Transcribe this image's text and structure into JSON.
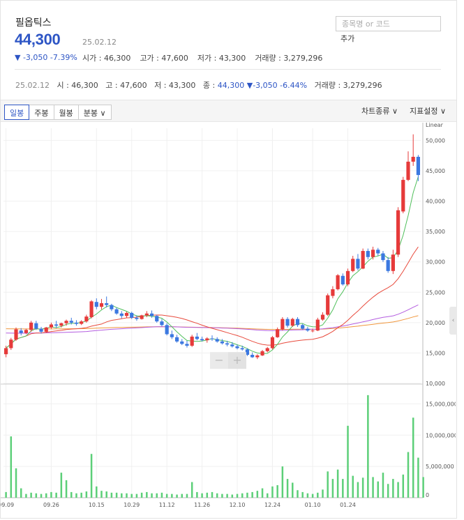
{
  "stock": {
    "name": "필옵틱스",
    "price": "44,300",
    "date": "25.02.12",
    "change": "▼ -3,050  -7.39%",
    "open": "시가 : 46,300",
    "high": "고가 : 47,600",
    "low": "저가 : 43,300",
    "volume": "거래량 : 3,279,296"
  },
  "search": {
    "placeholder": "종목명 or 코드",
    "add_label": "추가"
  },
  "ohlc_line": {
    "date": "25.02.12",
    "open": "시 : 46,300",
    "high": "고 : 47,600",
    "low": "저 : 43,300",
    "close_label": "종 :",
    "close": "44,300",
    "change": "▼-3,050 -6.44%",
    "volume": "거래량 : 3,279,296"
  },
  "toolbar": {
    "tabs": [
      "일봉",
      "주봉",
      "월봉",
      "분봉 ∨"
    ],
    "chart_type": "차트종류 ∨",
    "indicator": "지표설정 ∨"
  },
  "colors": {
    "up": "#e63a3a",
    "down": "#3b78e0",
    "ma5": "#4fbf5a",
    "ma20": "#e84a3c",
    "ma60": "#b45de0",
    "ma120": "#f0963c",
    "volume": "#5ccf78"
  },
  "chart_data": {
    "type": "candlestick",
    "scale_label": "Linear",
    "price_ticks": [
      "50,000",
      "45,000",
      "40,000",
      "35,000",
      "30,000",
      "25,000",
      "20,000",
      "15,000",
      "10,000"
    ],
    "volume_ticks": [
      "15,000,000",
      "10,000,000",
      "5,000,000",
      "0"
    ],
    "x_ticks": [
      "09.09",
      "09.26",
      "10.15",
      "10.29",
      "11.12",
      "11.26",
      "12.10",
      "12.24",
      "01.10",
      "01.24"
    ],
    "ylim": [
      10000,
      52000
    ],
    "candles": [
      [
        14800,
        16200,
        14300,
        15800
      ],
      [
        15800,
        17500,
        15500,
        17200
      ],
      [
        17200,
        19200,
        17000,
        18900
      ],
      [
        18700,
        19100,
        17900,
        18300
      ],
      [
        18300,
        19000,
        18100,
        18800
      ],
      [
        18800,
        20300,
        18500,
        20000
      ],
      [
        19900,
        20300,
        18800,
        19000
      ],
      [
        19000,
        19300,
        18200,
        18500
      ],
      [
        18500,
        19300,
        18300,
        19200
      ],
      [
        19200,
        20000,
        19000,
        19700
      ],
      [
        19700,
        20300,
        19100,
        19500
      ],
      [
        19500,
        20000,
        19200,
        19900
      ],
      [
        19900,
        20500,
        19500,
        20300
      ],
      [
        20300,
        20800,
        19700,
        20000
      ],
      [
        20000,
        20400,
        19500,
        19800
      ],
      [
        19800,
        20400,
        19600,
        20200
      ],
      [
        20200,
        21300,
        20000,
        21000
      ],
      [
        20900,
        23700,
        20700,
        23500
      ],
      [
        23400,
        24000,
        22200,
        22600
      ],
      [
        22600,
        23900,
        22200,
        23200
      ],
      [
        23200,
        24300,
        22500,
        22900
      ],
      [
        22900,
        23100,
        21900,
        22200
      ],
      [
        22200,
        22500,
        21300,
        21500
      ],
      [
        21500,
        21900,
        20700,
        21100
      ],
      [
        21100,
        21800,
        20800,
        21600
      ],
      [
        21600,
        21800,
        20600,
        20800
      ],
      [
        20800,
        21200,
        20300,
        20600
      ],
      [
        20600,
        21300,
        20500,
        21200
      ],
      [
        21200,
        21900,
        20900,
        21500
      ],
      [
        21500,
        22000,
        20800,
        21100
      ],
      [
        21100,
        21300,
        20000,
        20200
      ],
      [
        20200,
        20600,
        19400,
        19600
      ],
      [
        19600,
        19900,
        17900,
        18100
      ],
      [
        18100,
        18700,
        17300,
        17600
      ],
      [
        17600,
        18000,
        16700,
        16900
      ],
      [
        16900,
        17300,
        16300,
        16500
      ],
      [
        16500,
        17000,
        15900,
        16200
      ],
      [
        16200,
        18000,
        16000,
        17700
      ],
      [
        17700,
        18300,
        17100,
        17300
      ],
      [
        17300,
        17700,
        16900,
        17100
      ],
      [
        17100,
        17600,
        16700,
        17400
      ],
      [
        17400,
        17900,
        17000,
        17300
      ],
      [
        17300,
        17600,
        16700,
        16900
      ],
      [
        16900,
        17300,
        16400,
        16600
      ],
      [
        16600,
        17000,
        16100,
        16400
      ],
      [
        16400,
        16800,
        15900,
        16100
      ],
      [
        16100,
        16400,
        15600,
        15800
      ],
      [
        15800,
        16200,
        15400,
        15600
      ],
      [
        15600,
        15800,
        14500,
        14700
      ],
      [
        14700,
        15100,
        14200,
        14300
      ],
      [
        14300,
        14800,
        14000,
        14600
      ],
      [
        14600,
        15500,
        14500,
        15300
      ],
      [
        15300,
        16000,
        15100,
        15800
      ],
      [
        15800,
        17800,
        15600,
        17600
      ],
      [
        17600,
        19200,
        17500,
        18900
      ],
      [
        18900,
        20900,
        18700,
        20600
      ],
      [
        20600,
        20900,
        19200,
        19500
      ],
      [
        19500,
        20800,
        19300,
        20600
      ],
      [
        20600,
        20900,
        19300,
        19600
      ],
      [
        19600,
        19800,
        18800,
        19000
      ],
      [
        19000,
        19300,
        18500,
        18700
      ],
      [
        18700,
        19000,
        18400,
        18700
      ],
      [
        18700,
        20800,
        18600,
        20500
      ],
      [
        20500,
        21700,
        20300,
        21300
      ],
      [
        21300,
        24800,
        21100,
        24500
      ],
      [
        24400,
        26000,
        24000,
        25500
      ],
      [
        25500,
        28000,
        25300,
        27800
      ],
      [
        27700,
        28100,
        26100,
        26300
      ],
      [
        26300,
        28900,
        26000,
        28500
      ],
      [
        28500,
        31000,
        28300,
        30500
      ],
      [
        30500,
        31300,
        28600,
        28900
      ],
      [
        28900,
        32200,
        28800,
        31800
      ],
      [
        31800,
        32200,
        30400,
        30800
      ],
      [
        30800,
        32500,
        30400,
        32000
      ],
      [
        32000,
        32300,
        31000,
        31400
      ],
      [
        31400,
        31800,
        30000,
        30300
      ],
      [
        30300,
        30800,
        28200,
        28500
      ],
      [
        28500,
        32000,
        28000,
        31200
      ],
      [
        31200,
        39000,
        30800,
        38500
      ],
      [
        38300,
        44000,
        38000,
        43500
      ],
      [
        43500,
        48200,
        43300,
        46500
      ],
      [
        46500,
        51000,
        45800,
        47300
      ],
      [
        47300,
        47600,
        43300,
        44300
      ]
    ],
    "volumes": [
      0.9,
      9.8,
      4.7,
      1.5,
      0.6,
      0.8,
      0.7,
      0.6,
      0.7,
      0.9,
      0.8,
      4.0,
      2.8,
      0.9,
      0.7,
      0.8,
      1.0,
      7.0,
      1.8,
      1.1,
      1.0,
      0.8,
      0.8,
      0.7,
      0.7,
      0.6,
      0.6,
      0.8,
      0.9,
      0.7,
      0.7,
      0.8,
      0.6,
      0.6,
      0.5,
      0.6,
      0.6,
      2.5,
      0.9,
      0.7,
      0.8,
      0.9,
      0.7,
      0.6,
      0.6,
      0.5,
      0.6,
      0.7,
      0.8,
      0.9,
      1.1,
      1.5,
      0.7,
      1.8,
      2.0,
      5.0,
      3.0,
      2.4,
      1.2,
      0.9,
      0.7,
      0.6,
      0.8,
      1.3,
      4.2,
      3.0,
      4.5,
      3.0,
      11.5,
      3.5,
      2.5,
      3.2,
      16.4,
      3.3,
      2.6,
      4.0,
      2.2,
      3.0,
      2.5,
      3.7,
      7.3,
      12.8,
      6.4,
      3.3
    ]
  }
}
